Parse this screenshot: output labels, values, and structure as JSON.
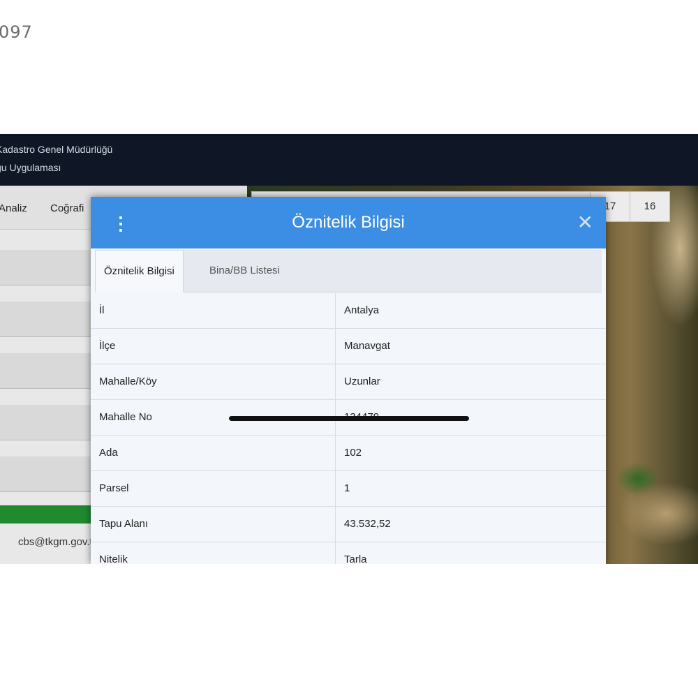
{
  "corner_id": "097",
  "header": {
    "org_name": "Kadastro Genel Müdürlüğü",
    "app_name": "gu Uygulaması"
  },
  "menu": {
    "items": [
      "Analiz",
      "Coğrafi"
    ]
  },
  "footer": {
    "email": "cbs@tkgm.gov.tr"
  },
  "map_toolbar": {
    "zoom_levels": [
      "17",
      "16"
    ]
  },
  "modal": {
    "title": "Öznitelik Bilgisi",
    "tabs": [
      "Öznitelik Bilgisi",
      "Bina/BB Listesi"
    ],
    "active_tab": 0,
    "rows": [
      {
        "key": "İl",
        "value": "Antalya"
      },
      {
        "key": "İlçe",
        "value": "Manavgat"
      },
      {
        "key": "Mahalle/Köy",
        "value": "Uzunlar"
      },
      {
        "key": "Mahalle No",
        "value": "134479"
      },
      {
        "key": "Ada",
        "value": "102"
      },
      {
        "key": "Parsel",
        "value": "1"
      },
      {
        "key": "Tapu Alanı",
        "value": "43.532,52"
      },
      {
        "key": "Nitelik",
        "value": "Tarla"
      }
    ]
  },
  "colors": {
    "modal_header": "#3b8ee4",
    "app_header": "#0f1726",
    "green_button": "#1f8a2e"
  },
  "icons": {
    "menu": "kebab-menu-icon",
    "close": "close-icon"
  }
}
